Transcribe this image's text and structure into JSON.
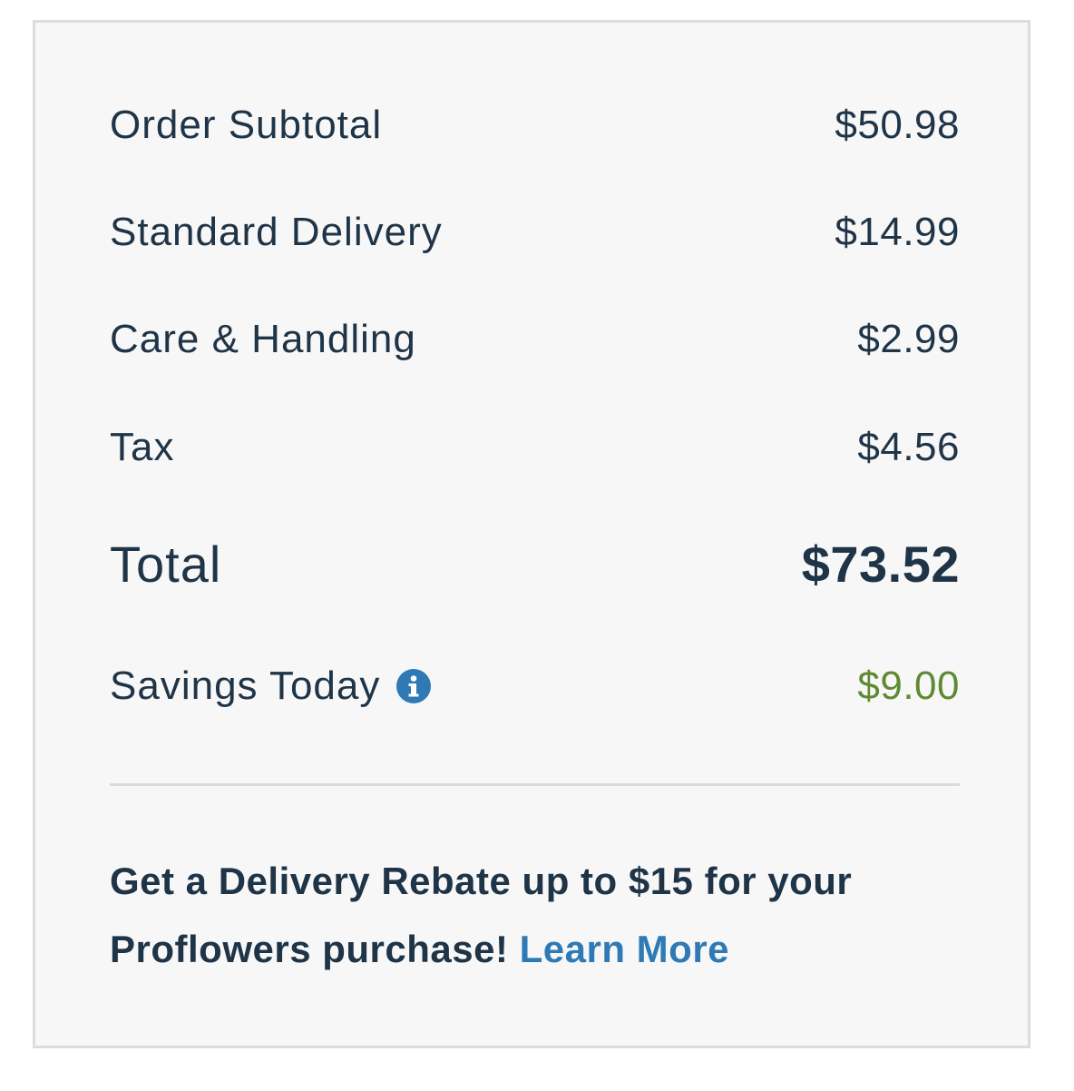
{
  "summary": {
    "rows": [
      {
        "label": "Order Subtotal",
        "value": "$50.98"
      },
      {
        "label": "Standard Delivery",
        "value": "$14.99"
      },
      {
        "label": "Care & Handling",
        "value": "$2.99"
      },
      {
        "label": "Tax",
        "value": "$4.56"
      }
    ],
    "total": {
      "label": "Total",
      "value": "$73.52"
    },
    "savings": {
      "label": "Savings Today",
      "value": "$9.00",
      "icon": "info-icon"
    }
  },
  "rebate": {
    "text": "Get a Delivery Rebate up to $15 for your Proflowers purchase!",
    "link_label": "Learn More"
  },
  "colors": {
    "text": "#1f3547",
    "savings": "#5e8a32",
    "link": "#2f7ab4",
    "info_icon": "#2f7ab4",
    "card_bg": "#f7f7f8",
    "border": "#dcdcde"
  }
}
